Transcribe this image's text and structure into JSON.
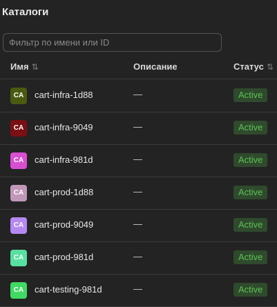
{
  "header": {
    "title": "Каталоги"
  },
  "filter": {
    "placeholder": "Фильтр по имени или ID",
    "value": ""
  },
  "table": {
    "columns": {
      "name": "Имя",
      "description": "Описание",
      "status": "Статус"
    },
    "rows": [
      {
        "avatar": "CA",
        "avatar_color": "#4a5a10",
        "avatar_text_color": "#ffffff",
        "name": "cart-infra-1d88",
        "description": "—",
        "status": "Active"
      },
      {
        "avatar": "CA",
        "avatar_color": "#7a0f14",
        "avatar_text_color": "#ffffff",
        "name": "cart-infra-9049",
        "description": "—",
        "status": "Active"
      },
      {
        "avatar": "CA",
        "avatar_color": "#d84fd0",
        "avatar_text_color": "#ffffff",
        "name": "cart-infra-981d",
        "description": "—",
        "status": "Active"
      },
      {
        "avatar": "CA",
        "avatar_color": "#c197b8",
        "avatar_text_color": "#ffffff",
        "name": "cart-prod-1d88",
        "description": "—",
        "status": "Active"
      },
      {
        "avatar": "CA",
        "avatar_color": "#b589f3",
        "avatar_text_color": "#ffffff",
        "name": "cart-prod-9049",
        "description": "—",
        "status": "Active"
      },
      {
        "avatar": "CA",
        "avatar_color": "#57e0a0",
        "avatar_text_color": "#ffffff",
        "name": "cart-prod-981d",
        "description": "—",
        "status": "Active"
      },
      {
        "avatar": "CA",
        "avatar_color": "#3fd964",
        "avatar_text_color": "#ffffff",
        "name": "cart-testing-981d",
        "description": "—",
        "status": "Active"
      }
    ]
  },
  "colors": {
    "background": "#232323",
    "status_active_bg": "#2f4a2c",
    "status_active_text": "#5cc157",
    "divider": "#3c3c3c"
  },
  "icons": {
    "sort": "sort-arrows-icon"
  }
}
